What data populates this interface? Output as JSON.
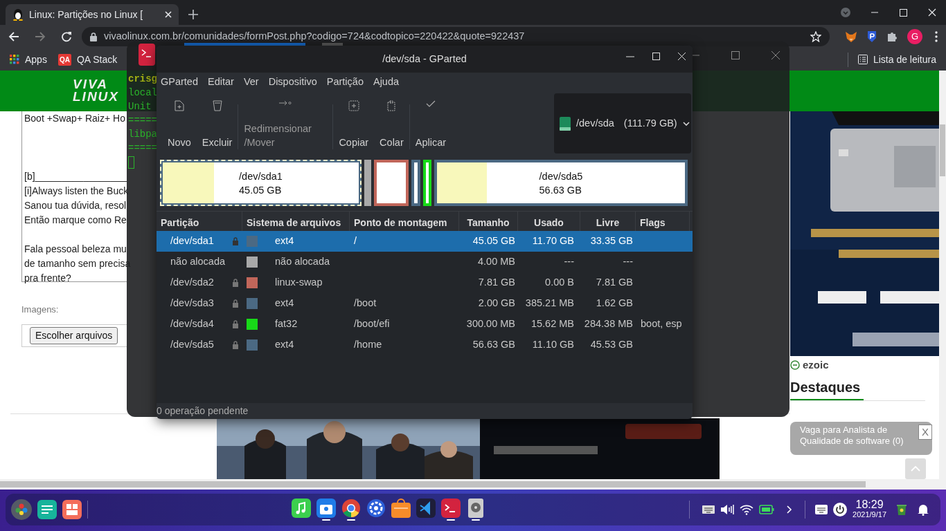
{
  "browser": {
    "tab": {
      "title": "Linux: Partições no Linux [",
      "selected": true
    },
    "address": "vivaolinux.com.br/comunidades/formPost.php?codigo=724&codtopico=220422&quote=922437",
    "profile": "G",
    "bookmarks": [
      {
        "kind": "apps",
        "label": "Apps"
      },
      {
        "kind": "qa",
        "badge": "QA",
        "label": "QA Stack"
      }
    ],
    "reading_list": "Lista de leitura"
  },
  "page": {
    "logo": [
      "VIVA",
      "LINUX"
    ],
    "post_paragraphs": [
      [
        {
          "text": "Boot +Swap+ Raiz+ Ho"
        }
      ],
      [
        {
          "text": "[b]_________________"
        },
        {
          "text": "[i]Always listen the Buck"
        },
        {
          "text": "Sanou tua dúvida, resol"
        },
        {
          "text": "Então marque como Re"
        }
      ],
      [
        {
          "text": "Fala pessoal beleza mu"
        },
        {
          "text": "de tamanho sem precisa"
        },
        {
          "text": "pra frente?"
        }
      ]
    ],
    "images_label": "Imagens:",
    "file_button": "Escolher arquivos",
    "ad_brand": "ezoic",
    "heading": "Destaques",
    "toast": {
      "text": "Vaga para Analista de Qualidade de software (0)",
      "close": "X"
    }
  },
  "terminal": {
    "lines": [
      {
        "kind": "prompt",
        "text": "crisg"
      },
      {
        "kind": "output",
        "text": "local"
      },
      {
        "kind": "output",
        "text": "Unit"
      },
      {
        "kind": "output",
        "text": "====="
      },
      {
        "kind": "output",
        "text": "libpa"
      },
      {
        "kind": "output",
        "text": "====="
      }
    ]
  },
  "gparted": {
    "title": "/dev/sda - GParted",
    "menu": [
      "GParted",
      "Editar",
      "Ver",
      "Dispositivo",
      "Partição",
      "Ajuda"
    ],
    "tool_groups": [
      [
        {
          "kind": "new",
          "label": "Novo",
          "disabled": false
        },
        {
          "kind": "delete",
          "label": "Excluir",
          "disabled": false
        }
      ],
      [
        {
          "kind": "resize",
          "label": "Redimensionar /Mover",
          "disabled": true
        }
      ],
      [
        {
          "kind": "copy",
          "label": "Copiar",
          "disabled": false
        },
        {
          "kind": "paste",
          "label": "Colar",
          "disabled": false
        }
      ],
      [
        {
          "kind": "apply",
          "label": "Aplicar",
          "disabled": false
        }
      ]
    ],
    "device": {
      "name": "/dev/sda",
      "size": "(111.79 GB)"
    },
    "map": [
      {
        "kind": "partition",
        "name": "/dev/sda1",
        "size": "45.05 GB",
        "color": "#4b6983",
        "level": 0.26,
        "selected": true
      },
      {
        "kind": "unallocated",
        "color": "#a9a9a9",
        "selected": false
      },
      {
        "kind": "partition",
        "color": "#c1665a",
        "selected": false
      },
      {
        "kind": "partition",
        "color": "#4b6983",
        "selected": false
      },
      {
        "kind": "partition",
        "color": "#18d918",
        "selected": false
      },
      {
        "kind": "partition",
        "name": "/dev/sda5",
        "size": "56.63 GB",
        "color": "#4b6983",
        "level": 0.2,
        "selected": false
      }
    ],
    "columns": [
      "Partição",
      "Sistema de arquivos",
      "Ponto de montagem",
      "Tamanho",
      "Usado",
      "Livre",
      "Flags"
    ],
    "rows": [
      {
        "partition": "/dev/sda1",
        "mounted": true,
        "color": "#4b6983",
        "filesystem": "ext4",
        "mount": "/",
        "size": "45.05 GB",
        "used": "11.70 GB",
        "free": "33.35 GB",
        "selected": true
      },
      {
        "partition": "não alocada",
        "mounted": false,
        "color": "#a9a9a9",
        "filesystem": "não alocada",
        "size": "4.00 MB",
        "used": "---",
        "free": "---",
        "selected": false
      },
      {
        "partition": "/dev/sda2",
        "mounted": true,
        "color": "#c1665a",
        "filesystem": "linux-swap",
        "size": "7.81 GB",
        "used": "0.00 B",
        "free": "7.81 GB",
        "selected": false
      },
      {
        "partition": "/dev/sda3",
        "mounted": true,
        "color": "#4b6983",
        "filesystem": "ext4",
        "mount": "/boot",
        "size": "2.00 GB",
        "used": "385.21 MB",
        "free": "1.62 GB",
        "selected": false
      },
      {
        "partition": "/dev/sda4",
        "mounted": true,
        "color": "#18d918",
        "filesystem": "fat32",
        "mount": "/boot/efi",
        "size": "300.00 MB",
        "used": "15.62 MB",
        "free": "284.38 MB",
        "flags": "boot, esp",
        "selected": false
      },
      {
        "partition": "/dev/sda5",
        "mounted": true,
        "color": "#4b6983",
        "filesystem": "ext4",
        "mount": "/home",
        "size": "56.63 GB",
        "used": "11.10 GB",
        "free": "45.53 GB",
        "selected": false
      }
    ],
    "status": "0 operação pendente"
  },
  "taskbar": {
    "apps": [
      {
        "kind": "music",
        "running": false
      },
      {
        "kind": "appstore",
        "running": true
      },
      {
        "kind": "chrome",
        "running": true
      },
      {
        "kind": "settings",
        "running": false
      },
      {
        "kind": "shop",
        "running": false
      },
      {
        "kind": "vscode",
        "running": false
      },
      {
        "kind": "terminal",
        "running": true
      },
      {
        "kind": "disk",
        "running": true
      }
    ],
    "time": "18:29",
    "date": "2021/9/17"
  }
}
